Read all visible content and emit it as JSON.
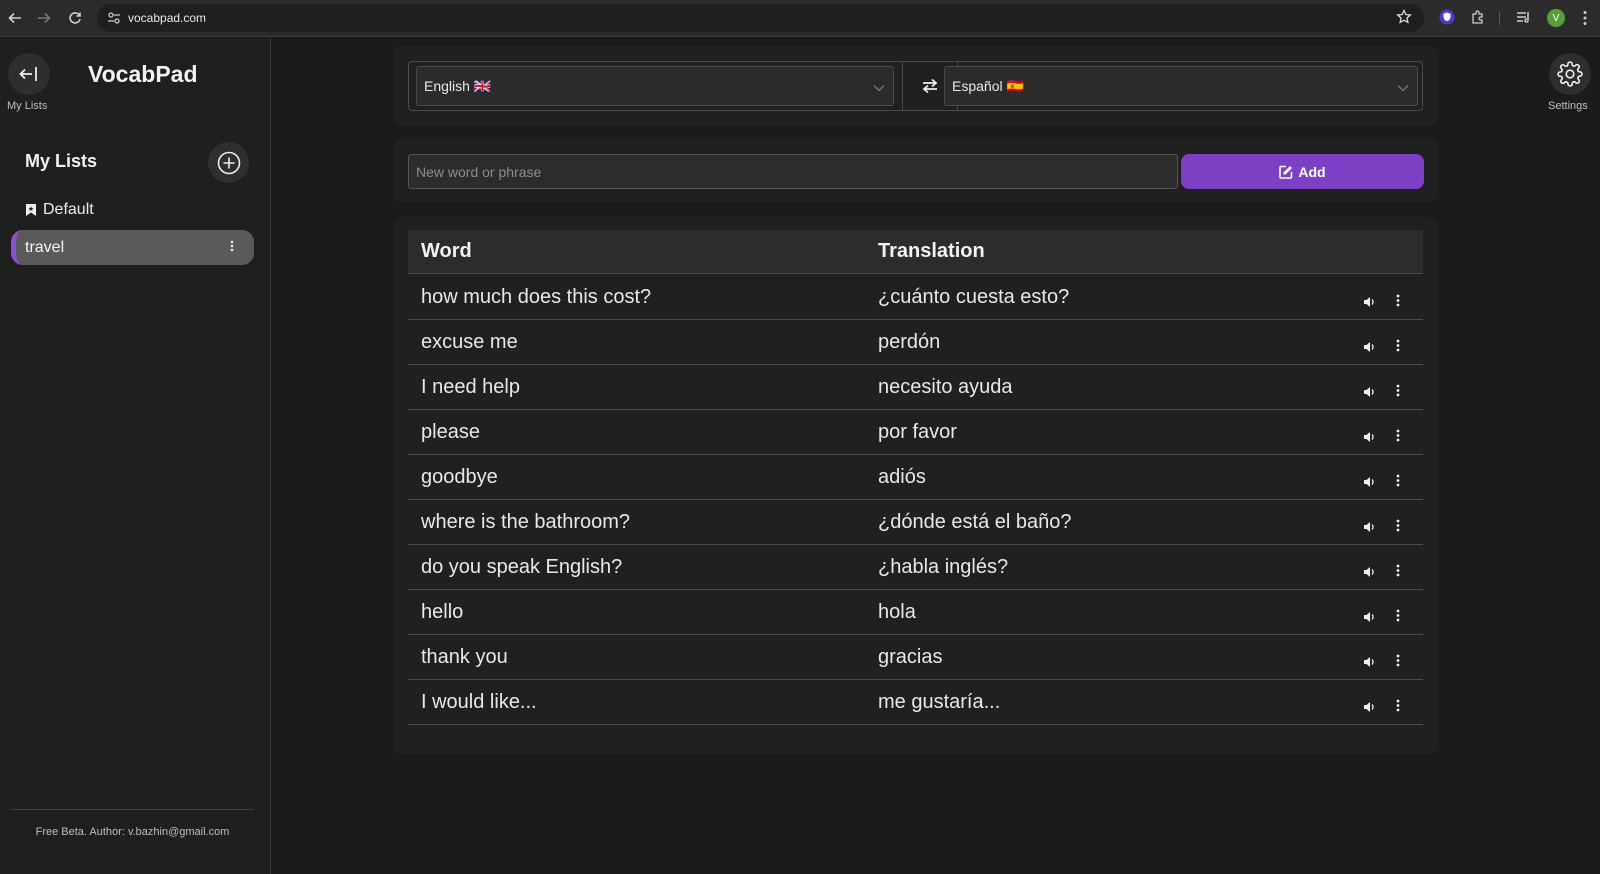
{
  "browser": {
    "url": "vocabpad.com",
    "profile_initial": "V"
  },
  "sidebar": {
    "back_label": "My Lists",
    "brand": "VocabPad",
    "lists_title": "My Lists",
    "lists": [
      {
        "label": "Default",
        "icon": "bookmark-icon",
        "active": false
      },
      {
        "label": "travel",
        "active": true
      }
    ],
    "footer": "Free Beta. Author: v.bazhin@gmail.com"
  },
  "languages": {
    "source": "English 🇬🇧",
    "target": "Español 🇪🇸"
  },
  "add_form": {
    "placeholder": "New word or phrase",
    "value": "",
    "button_label": "Add"
  },
  "table": {
    "headers": {
      "word": "Word",
      "translation": "Translation"
    },
    "rows": [
      {
        "word": "how much does this cost?",
        "translation": "¿cuánto cuesta esto?"
      },
      {
        "word": "excuse me",
        "translation": "perdón"
      },
      {
        "word": "I need help",
        "translation": "necesito ayuda"
      },
      {
        "word": "please",
        "translation": "por favor"
      },
      {
        "word": "goodbye",
        "translation": "adiós"
      },
      {
        "word": "where is the bathroom?",
        "translation": "¿dónde está el baño?"
      },
      {
        "word": "do you speak English?",
        "translation": "¿habla inglés?"
      },
      {
        "word": "hello",
        "translation": "hola"
      },
      {
        "word": "thank you",
        "translation": "gracias"
      },
      {
        "word": "I would like...",
        "translation": "me gustaría..."
      }
    ]
  },
  "settings": {
    "label": "Settings"
  },
  "colors": {
    "accent": "#7b40c4",
    "active_list_border": "#8a52d1",
    "background": "#1b1b1b"
  }
}
